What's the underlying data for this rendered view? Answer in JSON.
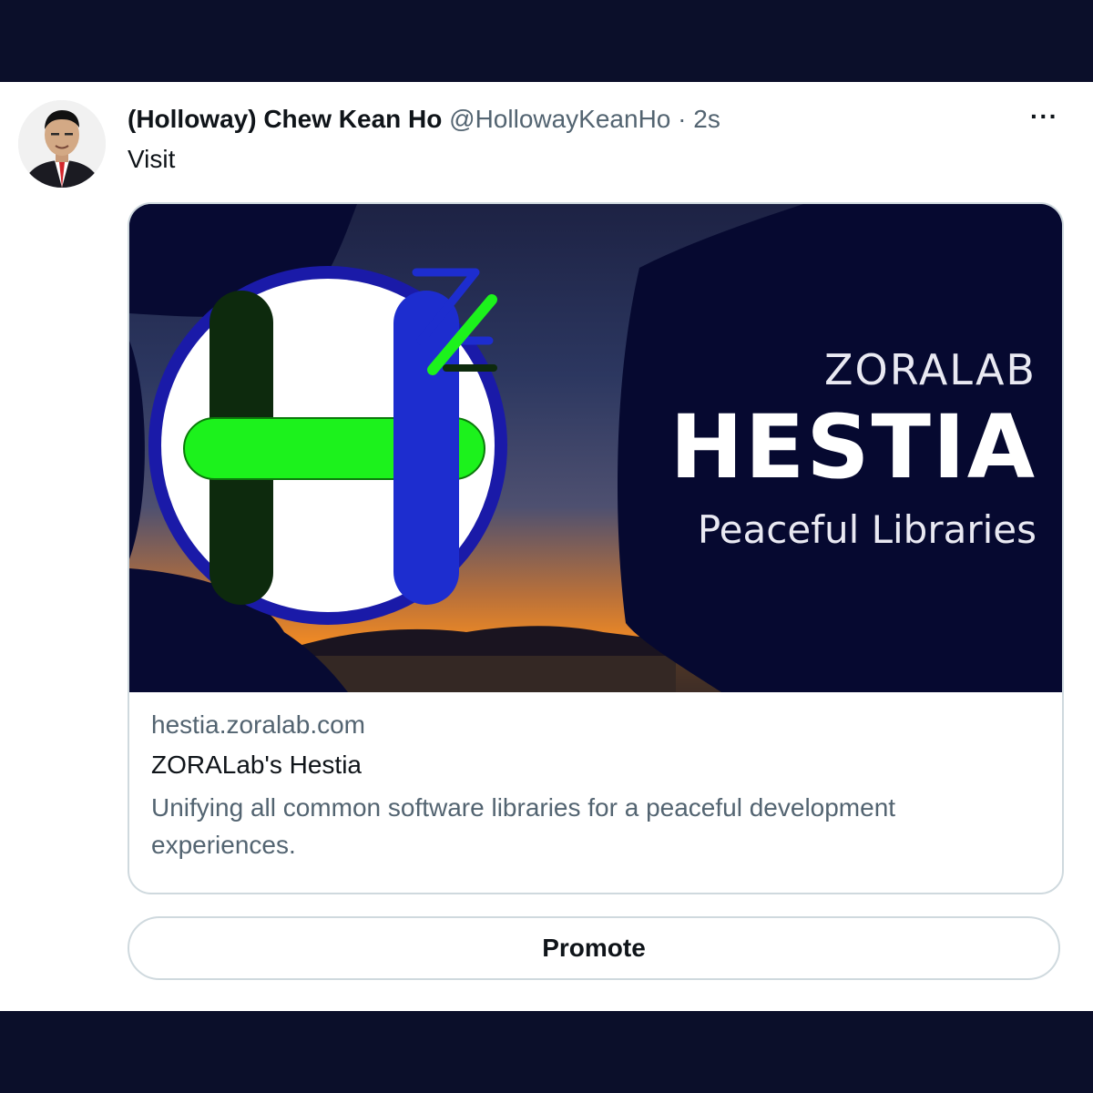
{
  "tweet": {
    "author_name": "(Holloway) Chew Kean Ho",
    "handle": "@HollowayKeanHo",
    "separator": "·",
    "timestamp": "2s",
    "more_icon": "more-horizontal-icon",
    "more_glyph": "···",
    "text": "Visit"
  },
  "card": {
    "image": {
      "brand": "ZORALAB",
      "title": "HESTIA",
      "tagline": "Peaceful Libraries",
      "logo_letter": "H",
      "logo_mark": "Z"
    },
    "domain": "hestia.zoralab.com",
    "title": "ZORALab's Hestia",
    "description": "Unifying all common software libraries for a peaceful development experiences."
  },
  "promote": {
    "label": "Promote"
  },
  "colors": {
    "frame_bg": "#0b0f2a",
    "panel_navy": "#060930",
    "logo_blue": "#1d2dcf",
    "logo_green": "#1cf21c",
    "logo_dark_green": "#0d2a0d",
    "muted_text": "#536471"
  }
}
